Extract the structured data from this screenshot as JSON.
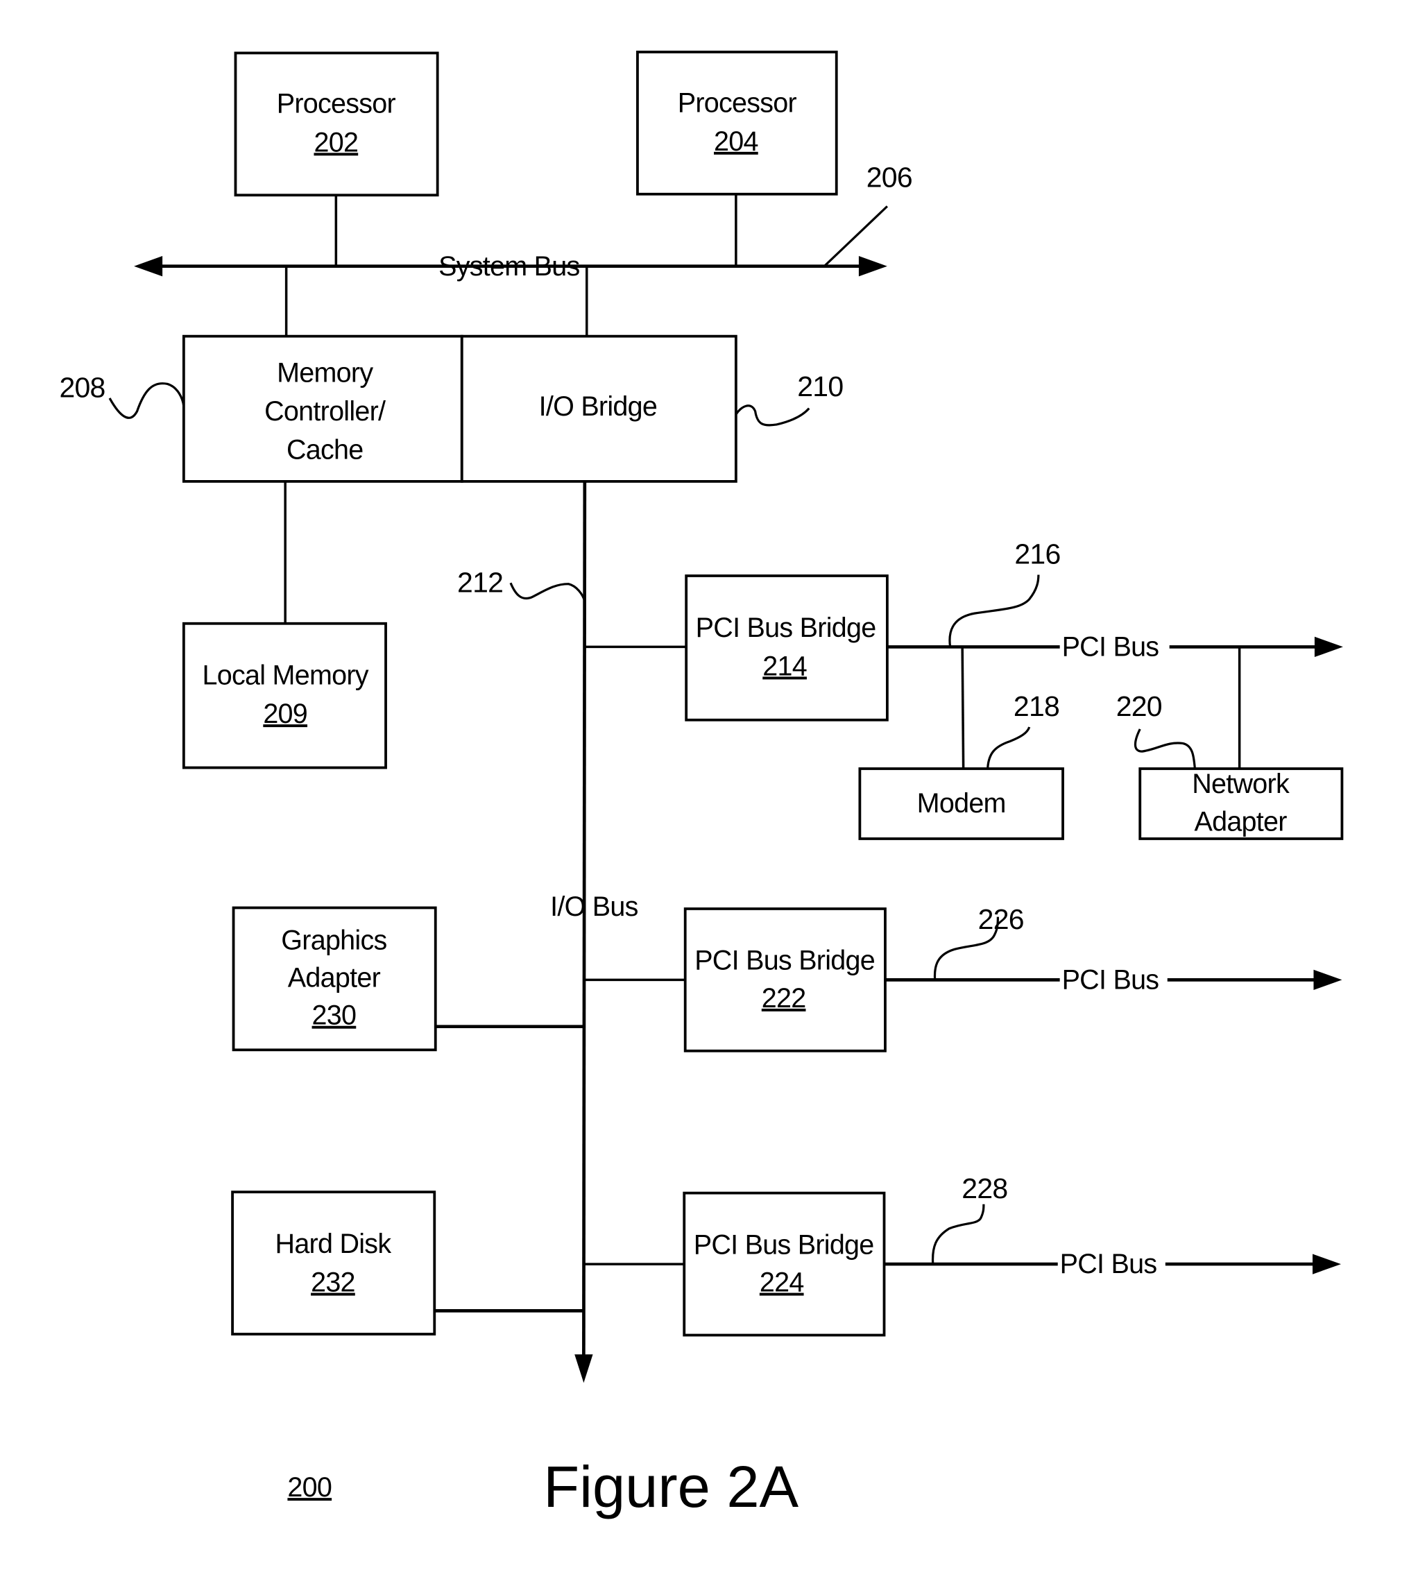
{
  "figure": {
    "title": "Figure 2A",
    "reference": "200"
  },
  "components": {
    "processor_202": {
      "label": "Processor",
      "ref": "202"
    },
    "processor_204": {
      "label": "Processor",
      "ref": "204"
    },
    "memory_controller": {
      "lines": [
        "Memory",
        "Controller/",
        "Cache"
      ]
    },
    "io_bridge": {
      "label": "I/O Bridge"
    },
    "local_memory": {
      "label": "Local Memory",
      "ref": "209"
    },
    "pci_bridge_214": {
      "label": "PCI Bus Bridge",
      "ref": "214"
    },
    "pci_bridge_222": {
      "label": "PCI Bus Bridge",
      "ref": "222"
    },
    "pci_bridge_224": {
      "label": "PCI Bus Bridge",
      "ref": "224"
    },
    "modem": {
      "label": "Modem"
    },
    "network_adapter": {
      "lines": [
        "Network",
        "Adapter"
      ]
    },
    "graphics_adapter": {
      "lines": [
        "Graphics",
        "Adapter"
      ],
      "ref": "230"
    },
    "hard_disk": {
      "label": "Hard Disk",
      "ref": "232"
    }
  },
  "buses": {
    "system_bus": "System Bus",
    "io_bus": "I/O Bus",
    "pci_bus": "PCI Bus"
  },
  "reference_numerals": {
    "system_bus": "206",
    "memory_controller": "208",
    "io_bridge": "210",
    "io_bus": "212",
    "pci_bus_214": "216",
    "modem": "218",
    "network_adapter": "220",
    "pci_bus_222": "226",
    "pci_bus_224": "228"
  }
}
